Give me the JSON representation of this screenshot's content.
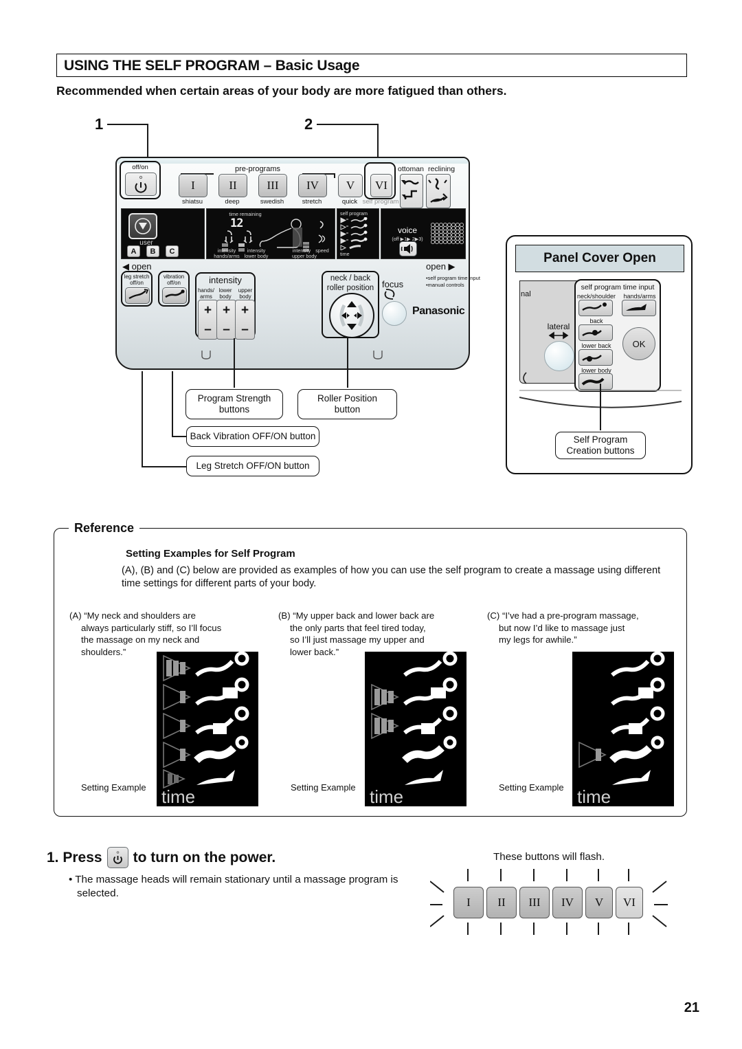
{
  "header": {
    "title": "USING THE SELF PROGRAM – Basic Usage",
    "subtitle": "Recommended when certain areas of your body are more fatigued than others."
  },
  "callout_numbers": {
    "one": "1",
    "two": "2"
  },
  "remote": {
    "power_label": "off/on",
    "preprograms_label": "pre-programs",
    "ottoman_label": "ottoman",
    "reclining_label": "reclining",
    "program_keys": [
      {
        "numeral": "I",
        "name": "shiatsu"
      },
      {
        "numeral": "II",
        "name": "deep"
      },
      {
        "numeral": "III",
        "name": "swedish"
      },
      {
        "numeral": "IV",
        "name": "stretch"
      },
      {
        "numeral": "V",
        "name": "quick"
      },
      {
        "numeral": "VI",
        "name": "self program"
      }
    ],
    "user_label": "user",
    "user_keys": [
      "A",
      "B",
      "C"
    ],
    "lcd": {
      "time_remaining": "time remaining",
      "minutes": "12",
      "intensity_hands_arms": [
        "intensity",
        "hands/arms"
      ],
      "intensity_lower_body": [
        "intensity",
        "lower body"
      ],
      "intensity_upper_body": [
        "intensity",
        "upper body"
      ],
      "speed": "speed",
      "self_program": "self program",
      "time": "time"
    },
    "voice": {
      "label": "voice",
      "sub": "(off ▶1▶ 2▶3)"
    },
    "open_left": "◀ open",
    "open_right": "open ▶",
    "open_notes": [
      "•self program time input",
      "•manual controls"
    ],
    "leg_stretch": [
      "leg stretch",
      "off/on"
    ],
    "vibration": [
      "vibration",
      "off/on"
    ],
    "intensity_label": "intensity",
    "intensity_groups": [
      [
        "hands/",
        "arms"
      ],
      [
        "lower",
        "body"
      ],
      [
        "upper",
        "body"
      ]
    ],
    "plus": "+",
    "minus": "–",
    "roller": [
      "neck / back",
      "roller position"
    ],
    "focus_label": "focus",
    "brand": "Panasonic"
  },
  "callouts": {
    "program_strength": "Program Strength\nbuttons",
    "roller_position": "Roller Position\nbutton",
    "back_vibration": "Back Vibration OFF/ON button",
    "leg_stretch": "Leg Stretch OFF/ON button",
    "self_program_creation": "Self Program\nCreation buttons"
  },
  "panel_cover_open": {
    "heading": "Panel Cover Open",
    "manual_label": "nal",
    "lateral_label": "lateral",
    "self_program_time_input": "self program time input",
    "buttons": [
      {
        "label": "neck/shoulder"
      },
      {
        "label": "hands/arms"
      },
      {
        "label": "back"
      },
      {
        "label": "lower back"
      },
      {
        "label": "lower body"
      }
    ],
    "ok_label": "OK"
  },
  "reference": {
    "title": "Reference",
    "subheading": "Setting Examples for Self Program",
    "body": "(A), (B) and (C) below are provided as examples of how you can use the self program to create a massage using different time settings for different parts of your body.",
    "setting_example_label": "Setting Example",
    "time_label": "time",
    "examples": [
      {
        "key": "A",
        "text": "(A) “My neck and shoulders are always particularly stiff, so I’ll focus the massage on my neck and shoulders.”",
        "lines": [
          "(A) “My neck and shoulders are",
          "always particularly stiff, so I’ll focus",
          "the massage on my neck and",
          "shoulders.”"
        ],
        "bars": [
          3,
          1,
          1,
          1,
          2
        ]
      },
      {
        "key": "B",
        "text": "(B) “My upper back and lower back are the only parts that feel tired today, so I’ll just massage my upper and lower back.”",
        "lines": [
          "(B) “My upper back and lower back are",
          "the only parts that feel tired today,",
          "so I’ll just massage my upper and",
          "lower back.”"
        ],
        "bars": [
          0,
          3,
          3,
          0,
          0
        ]
      },
      {
        "key": "C",
        "text": "(C) “I’ve had a pre-program massage, but now I’d like to massage just my legs for awhile.”",
        "lines": [
          "(C) “I’ve had a pre-program massage,",
          "but now I’d like to massage just",
          "my legs for awhile.”"
        ],
        "bars": [
          0,
          0,
          0,
          1,
          0
        ]
      }
    ]
  },
  "step": {
    "number": "1. Press",
    "tail": "to turn on the power.",
    "bullet": "• The massage heads will remain stationary until a massage program is selected.",
    "flash_note": "These buttons will flash.",
    "flash_keys": [
      "I",
      "II",
      "III",
      "IV",
      "V",
      "VI"
    ]
  },
  "page_number": "21"
}
